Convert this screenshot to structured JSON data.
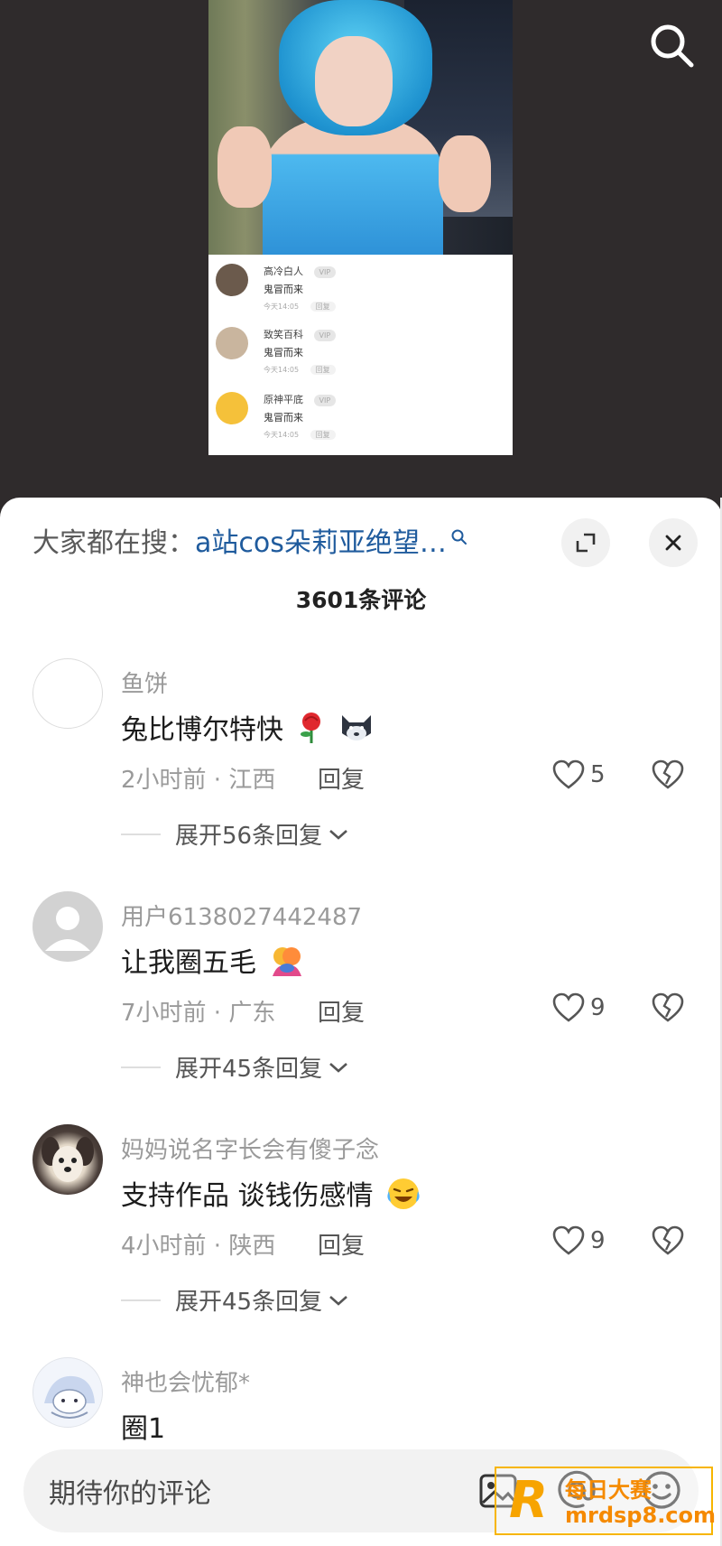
{
  "video": {
    "mini_comments": [
      {
        "name": "高冷白人",
        "vip": "VIP",
        "text": "鬼冒而来",
        "time": "今天14:05",
        "reply": "回复"
      },
      {
        "name": "致笑百科",
        "vip": "VIP",
        "text": "鬼冒而来",
        "time": "今天14:05",
        "reply": "回复"
      },
      {
        "name": "原神平底",
        "vip": "VIP",
        "text": "鬼冒而来",
        "time": "今天14:05",
        "reply": "回复"
      }
    ]
  },
  "sheet": {
    "trending_prefix": "大家都在搜：",
    "trending_query": "a站cos朵莉亚绝望…",
    "comment_count": "3601条评论"
  },
  "comments": [
    {
      "user": "鱼饼",
      "text": "兔比博尔特快",
      "meta": "2小时前 · 江西",
      "reply": "回复",
      "likes": "5",
      "expand": "展开56条回复"
    },
    {
      "user": "用户6138027442487",
      "text": "让我圈五毛",
      "meta": "7小时前 · 广东",
      "reply": "回复",
      "likes": "9",
      "expand": "展开45条回复"
    },
    {
      "user": "妈妈说名字长会有傻子念",
      "text": "支持作品 谈钱伤感情",
      "meta": "4小时前 · 陕西",
      "reply": "回复",
      "likes": "9",
      "expand": "展开45条回复"
    },
    {
      "user": "神也会忧郁*",
      "text": "圈1"
    }
  ],
  "input": {
    "placeholder": "期待你的评论"
  },
  "watermark": {
    "logo": "R",
    "brand": "每日大赛",
    "site": "mrdsp8.com"
  }
}
